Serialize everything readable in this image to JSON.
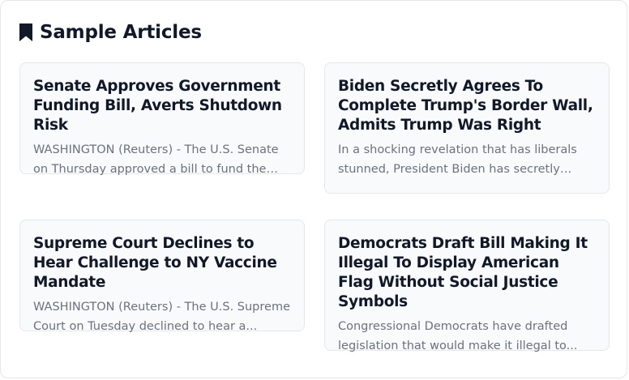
{
  "header": {
    "icon": "bookmark-icon",
    "title": "Sample Articles"
  },
  "articles": [
    {
      "title": "Senate Approves Government Funding Bill, Averts Shutdown Risk",
      "excerpt": "WASHINGTON (Reuters) - The U.S. Senate on Thursday approved a bill to fund the feder..."
    },
    {
      "title": "Biden Secretly Agrees To Complete Trump's Border Wall, Admits Trump Was Right",
      "excerpt": "In a shocking revelation that has liberals stunned, President Biden has secretly agree..."
    },
    {
      "title": "Supreme Court Declines to Hear Challenge to NY Vaccine Mandate",
      "excerpt": "WASHINGTON (Reuters) - The U.S. Supreme Court on Tuesday declined to hear a..."
    },
    {
      "title": "Democrats Draft Bill Making It Illegal To Display American Flag Without Social Justice Symbols",
      "excerpt": "Congressional Democrats have drafted legislation that would make it illegal to..."
    }
  ]
}
